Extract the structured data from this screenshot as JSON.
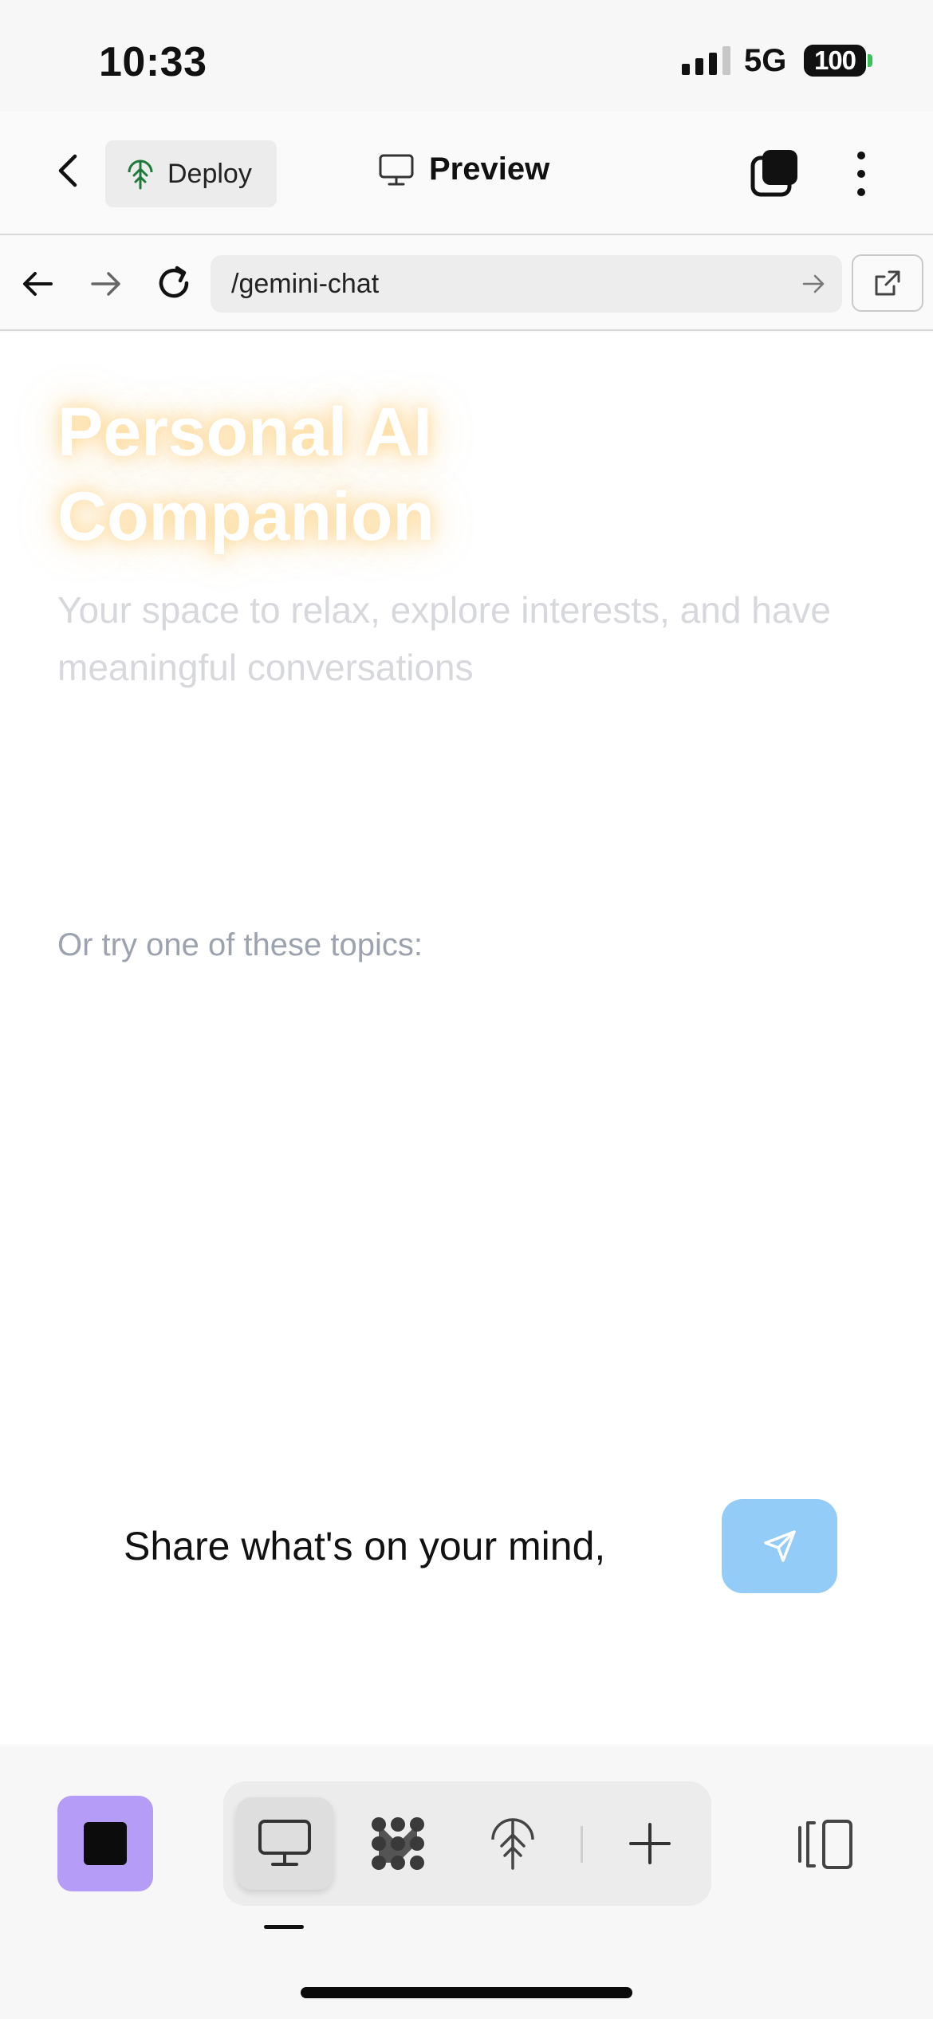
{
  "status_bar": {
    "time": "10:33",
    "network": "5G",
    "battery": "100"
  },
  "header": {
    "deploy_label": "Deploy",
    "preview_label": "Preview"
  },
  "browser": {
    "url": "/gemini-chat"
  },
  "hero": {
    "title_line1": "Personal AI",
    "title_line2": "Companion",
    "subtitle": "Your space to relax, explore interests, and have meaningful conversations"
  },
  "topics": {
    "label": "Or try one of these topics:"
  },
  "composer": {
    "placeholder_visible": "Share what's on your mind,"
  },
  "icons": {
    "back": "chevron-left-icon",
    "deploy": "deploy-tree-icon",
    "preview": "monitor-icon",
    "tabs": "tabs-icon",
    "more": "more-vertical-icon",
    "send": "send-icon",
    "stop": "stop-icon",
    "panel": "side-panel-icon"
  },
  "colors": {
    "send_button": "#93cdf7",
    "stop_button": "#b59cf6",
    "title_glow": "#fdc45a"
  }
}
